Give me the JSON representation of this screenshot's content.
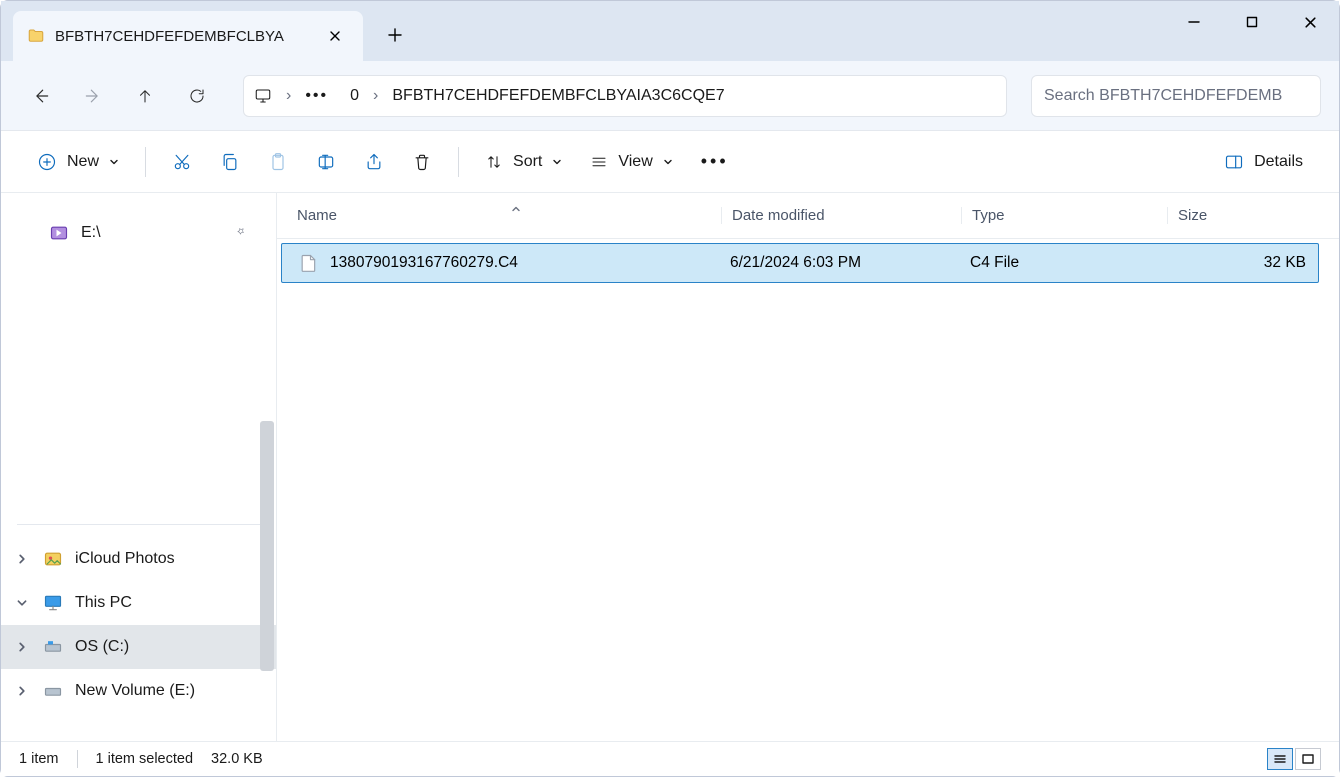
{
  "tab": {
    "title": "BFBTH7CEHDFEFDEMBFCLBYA"
  },
  "breadcrumb": {
    "drive": "0",
    "folder": "BFBTH7CEHDFEFDEMBFCLBYAIA3C6CQE7"
  },
  "search": {
    "placeholder": "Search BFBTH7CEHDFEFDEMB"
  },
  "toolbar": {
    "new_label": "New",
    "sort_label": "Sort",
    "view_label": "View",
    "details_label": "Details"
  },
  "sidebar": {
    "quick": {
      "label": "E:\\"
    },
    "items": [
      {
        "label": "iCloud Photos"
      },
      {
        "label": "This PC"
      },
      {
        "label": "OS (C:)"
      },
      {
        "label": "New Volume (E:)"
      }
    ]
  },
  "columns": {
    "name": "Name",
    "date": "Date modified",
    "type": "Type",
    "size": "Size"
  },
  "files": [
    {
      "name": "1380790193167760279.C4",
      "date": "6/21/2024 6:03 PM",
      "type": "C4 File",
      "size": "32 KB"
    }
  ],
  "status": {
    "count": "1 item",
    "selected": "1 item selected",
    "size": "32.0 KB"
  }
}
